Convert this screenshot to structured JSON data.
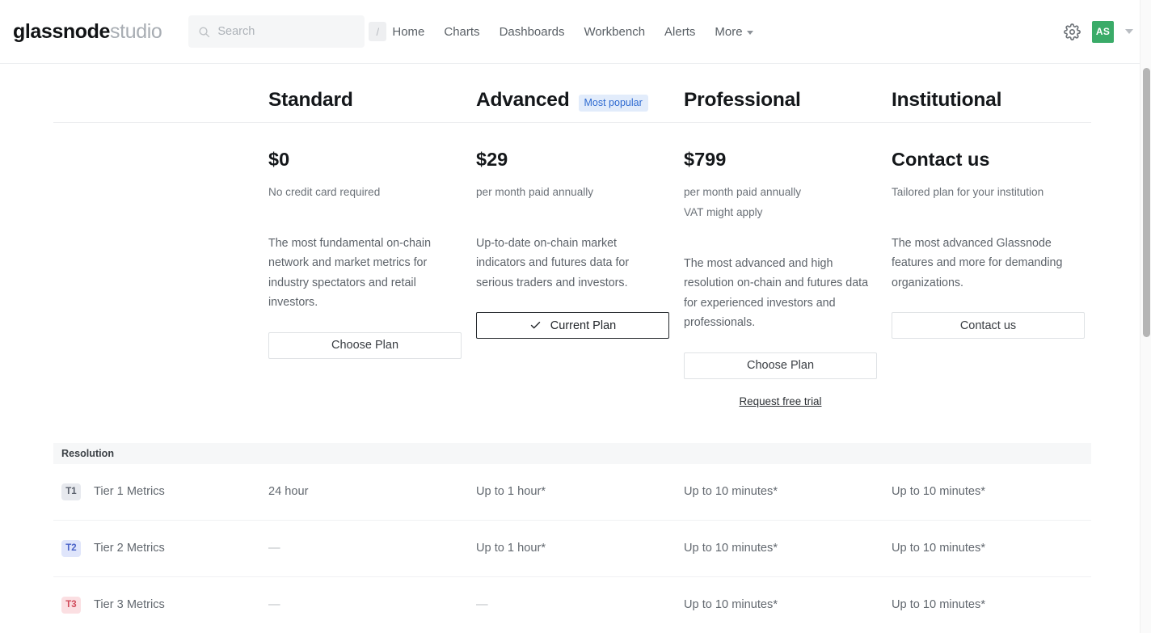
{
  "nav": {
    "logo_bold": "glassnode",
    "logo_light": "studio",
    "search": {
      "placeholder": "Search",
      "value": "",
      "shortcut": "/",
      "icon": "search-icon"
    },
    "links": [
      {
        "label": "Home"
      },
      {
        "label": "Charts"
      },
      {
        "label": "Dashboards"
      },
      {
        "label": "Workbench"
      },
      {
        "label": "Alerts"
      },
      {
        "label": "More",
        "has_chevron": true
      }
    ],
    "settings_icon": "gear-icon",
    "avatar_initials": "AS",
    "avatar_color": "#3aab68",
    "avatar_chevron_icon": "chevron-down-icon"
  },
  "pricing": {
    "plans": [
      {
        "name": "Standard",
        "badge": "",
        "price": "$0",
        "price_sub": [
          "No credit card required"
        ],
        "description": "The most fundamental on-chain network and market metrics for industry spectators and retail investors.",
        "cta_label": "Choose Plan",
        "cta_state": "default",
        "secondary_link": ""
      },
      {
        "name": "Advanced",
        "badge": "Most popular",
        "price": "$29",
        "price_sub": [
          "per month paid annually"
        ],
        "description": "Up-to-date on-chain market indicators and futures data for serious traders and investors.",
        "cta_label": "Current Plan",
        "cta_state": "current",
        "secondary_link": ""
      },
      {
        "name": "Professional",
        "badge": "",
        "price": "$799",
        "price_sub": [
          "per month paid annually",
          "VAT might apply"
        ],
        "description": "The most advanced and high resolution on-chain and futures data for experienced investors and professionals.",
        "cta_label": "Choose Plan",
        "cta_state": "default",
        "secondary_link": "Request free trial"
      },
      {
        "name": "Institutional",
        "badge": "",
        "price": "Contact us",
        "price_sub": [
          "Tailored plan for your institution"
        ],
        "description": "The most advanced Glassnode features and more for demanding organizations.",
        "cta_label": "Contact us",
        "cta_state": "default",
        "secondary_link": ""
      }
    ],
    "badge_colors": {
      "popular_bg": "#e2ecfb",
      "popular_text": "#2e6ad1"
    }
  },
  "features": {
    "section_title": "Resolution",
    "rows": [
      {
        "tier_badge": "T1",
        "tier_style": "t1",
        "name": "Tier 1 Metrics",
        "values": [
          "24 hour",
          "Up to 1 hour*",
          "Up to 10 minutes*",
          "Up to 10 minutes*"
        ]
      },
      {
        "tier_badge": "T2",
        "tier_style": "t2",
        "name": "Tier 2 Metrics",
        "values": [
          "—",
          "Up to 1 hour*",
          "Up to 10 minutes*",
          "Up to 10 minutes*"
        ]
      },
      {
        "tier_badge": "T3",
        "tier_style": "t3",
        "name": "Tier 3 Metrics",
        "values": [
          "—",
          "—",
          "Up to 10 minutes*",
          "Up to 10 minutes*"
        ]
      }
    ]
  }
}
